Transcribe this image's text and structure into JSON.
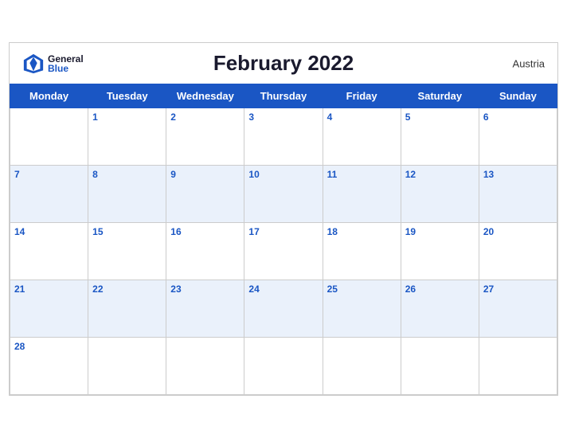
{
  "header": {
    "title": "February 2022",
    "country": "Austria",
    "logo": {
      "general": "General",
      "blue": "Blue"
    }
  },
  "days_of_week": [
    "Monday",
    "Tuesday",
    "Wednesday",
    "Thursday",
    "Friday",
    "Saturday",
    "Sunday"
  ],
  "weeks": [
    [
      null,
      1,
      2,
      3,
      4,
      5,
      6
    ],
    [
      7,
      8,
      9,
      10,
      11,
      12,
      13
    ],
    [
      14,
      15,
      16,
      17,
      18,
      19,
      20
    ],
    [
      21,
      22,
      23,
      24,
      25,
      26,
      27
    ],
    [
      28,
      null,
      null,
      null,
      null,
      null,
      null
    ]
  ]
}
